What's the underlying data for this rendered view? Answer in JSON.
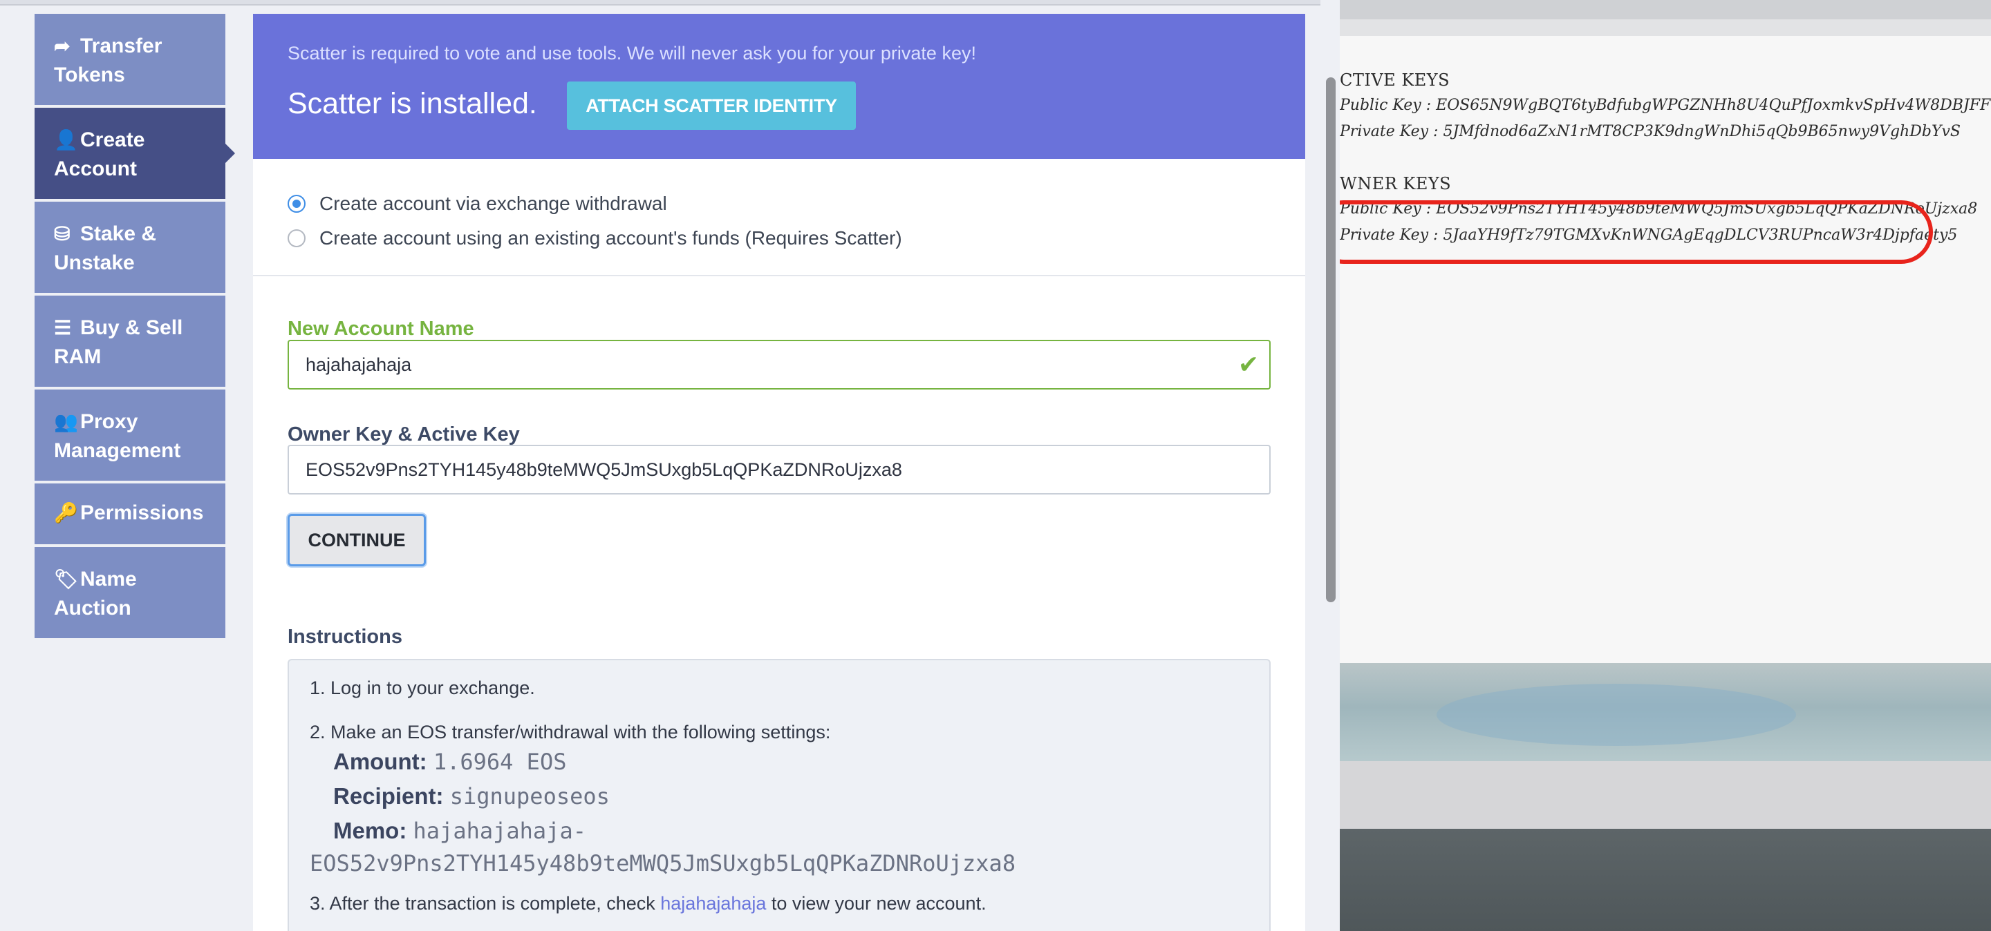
{
  "sidebar": {
    "items": [
      {
        "icon": "share-arrow-icon",
        "glyph": "➦",
        "label": "Transfer Tokens",
        "active": false
      },
      {
        "icon": "user-icon",
        "glyph": "👤",
        "label": "Create Account",
        "active": true
      },
      {
        "icon": "inbox-icon",
        "glyph": "⛁",
        "label": "Stake & Unstake",
        "active": false
      },
      {
        "icon": "server-icon",
        "glyph": "☰",
        "label": "Buy & Sell RAM",
        "active": false
      },
      {
        "icon": "users-icon",
        "glyph": "👥",
        "label": "Proxy Management",
        "active": false
      },
      {
        "icon": "key-icon",
        "glyph": "🔑",
        "label": "Permissions",
        "active": false
      },
      {
        "icon": "tag-icon",
        "glyph": "🏷",
        "label": "Name Auction",
        "active": false
      }
    ]
  },
  "banner": {
    "note": "Scatter is required to vote and use tools. We will never ask you for your private key!",
    "title": "Scatter is installed.",
    "attach_label": "ATTACH SCATTER IDENTITY"
  },
  "options": {
    "exchange": "Create account via exchange withdrawal",
    "existing": "Create account using an existing account's funds (Requires Scatter)",
    "selected": "exchange"
  },
  "form": {
    "name_label": "New Account Name",
    "name_value": "hajahajahaja",
    "key_label": "Owner Key & Active Key",
    "key_value": "EOS52v9Pns2TYH145y48b9teMWQ5JmSUxgb5LqQPKaZDNRoUjzxa8",
    "continue_label": "CONTINUE"
  },
  "instructions": {
    "label": "Instructions",
    "step1": "1. Log in to your exchange.",
    "step2": "2. Make an EOS transfer/withdrawal with the following settings:",
    "amount_label": "Amount:",
    "amount_value": "1.6964 EOS",
    "recipient_label": "Recipient:",
    "recipient_value": "signupeoseos",
    "memo_label": "Memo:",
    "memo_value_1": "hajahajahaja-",
    "memo_value_2": "EOS52v9Pns2TYH145y48b9teMWQ5JmSUxgb5LqQPKaZDNRoUjzxa8",
    "step3_pre": "3. After the transaction is complete, check ",
    "step3_link": "hajahajahaja",
    "step3_post": " to view your new account."
  },
  "photo": {
    "active_heading": "CTIVE KEYS",
    "active_public": "Public Key : EOS65N9WgBQT6tyBdfubgWPGZNHh8U4QuPfJoxmkvSpHv4W8DBJFF",
    "active_private": "Private Key : 5JMfdnod6aZxN1rMT8CP3K9dngWnDhi5qQb9B65nwy9VghDbYvS",
    "owner_heading": "WNER KEYS",
    "owner_public": "Public Key : EOS52v9Pns2TYH145y48b9teMWQ5JmSUxgb5LqQPKaZDNRoUjzxa8",
    "owner_private": "Private Key : 5JaaYH9fTz79TGMXvKnWNGAgEqgDLCV3RUPncaW3r4Djpfaety5",
    "highlight_color": "#e8241c"
  }
}
